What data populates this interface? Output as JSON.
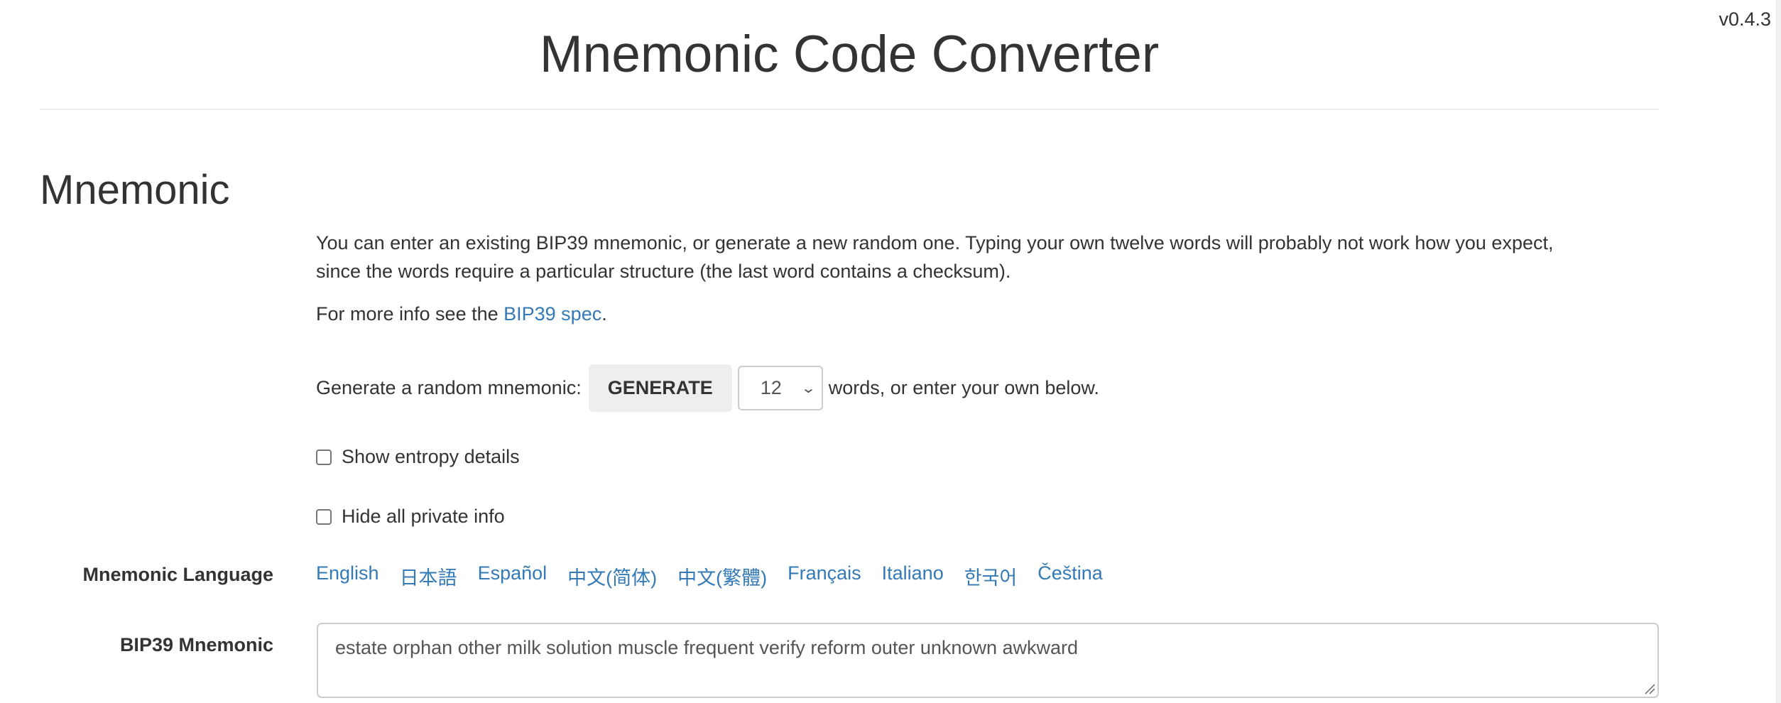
{
  "header": {
    "version": "v0.4.3",
    "title": "Mnemonic Code Converter"
  },
  "mnemonic_section": {
    "heading": "Mnemonic",
    "intro_line1": "You can enter an existing BIP39 mnemonic, or generate a new random one. Typing your own twelve words will probably not work how you expect,",
    "intro_line2": "since the words require a particular structure (the last word contains a checksum).",
    "more_info_prefix": "For more info see the ",
    "more_info_link": "BIP39 spec",
    "more_info_suffix": ".",
    "generate_prefix": "Generate a random mnemonic:",
    "generate_button": "GENERATE",
    "word_count_selected": "12",
    "generate_suffix": "words, or enter your own below.",
    "show_entropy_label": "Show entropy details",
    "show_entropy_checked": false,
    "hide_private_label": "Hide all private info",
    "hide_private_checked": false,
    "language_label": "Mnemonic Language",
    "languages": [
      "English",
      "日本語",
      "Español",
      "中文(简体)",
      "中文(繁體)",
      "Français",
      "Italiano",
      "한국어",
      "Čeština"
    ],
    "bip39_label": "BIP39 Mnemonic",
    "bip39_value": "estate orphan other milk solution muscle frequent verify reform outer unknown awkward"
  },
  "colors": {
    "text": "#333333",
    "link": "#337ab7",
    "button_bg": "#eeeeee",
    "border": "#cccccc"
  }
}
